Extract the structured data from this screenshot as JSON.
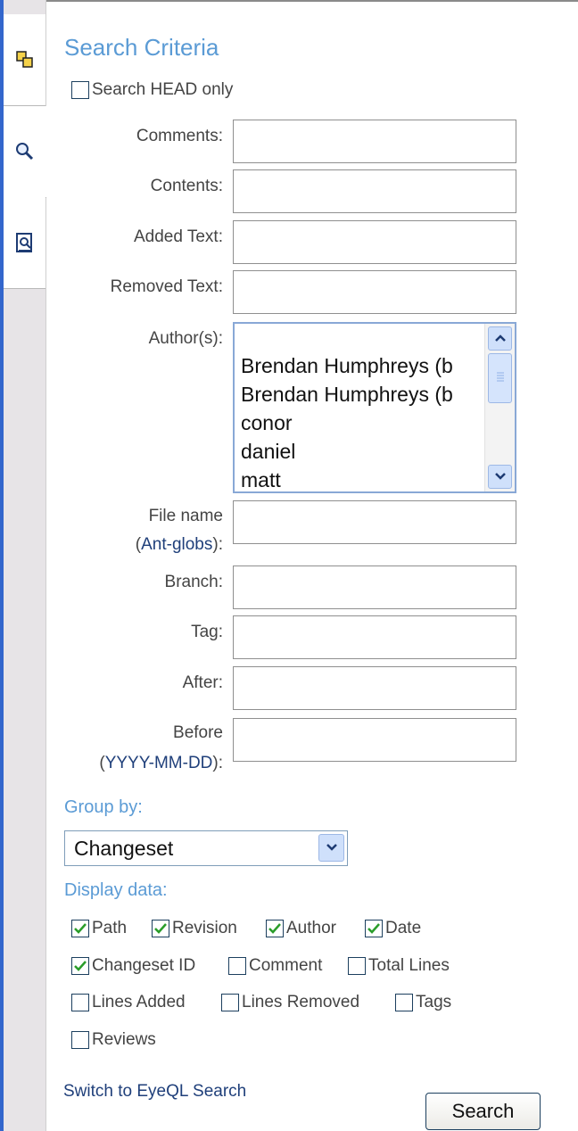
{
  "tabs": [
    {
      "icon": "changesets-icon"
    },
    {
      "icon": "search-icon"
    },
    {
      "icon": "reviews-icon"
    }
  ],
  "title": "Search Criteria",
  "head_only": {
    "label": "Search HEAD only",
    "checked": false
  },
  "fields": {
    "comments": {
      "label": "Comments:",
      "value": ""
    },
    "contents": {
      "label": "Contents:",
      "value": ""
    },
    "added_text": {
      "label": "Added Text:",
      "value": ""
    },
    "removed_text": {
      "label": "Removed Text:",
      "value": ""
    },
    "authors": {
      "label": "Author(s):",
      "options": [
        "",
        "Brendan Humphreys (b",
        "Brendan Humphreys (b",
        "conor",
        "daniel",
        "matt"
      ]
    },
    "file_name": {
      "label": "File name",
      "link": "Ant-globs",
      "open": "(",
      "close": "):",
      "value": ""
    },
    "branch": {
      "label": "Branch:",
      "value": ""
    },
    "tag": {
      "label": "Tag:",
      "value": ""
    },
    "after": {
      "label": "After:",
      "value": ""
    },
    "before": {
      "label": "Before",
      "link": "YYYY-MM-DD",
      "open": "(",
      "close": "):",
      "value": ""
    }
  },
  "group_by": {
    "label": "Group by:",
    "selected": "Changeset"
  },
  "display_data": {
    "label": "Display data:",
    "options": [
      {
        "label": "Path",
        "checked": true
      },
      {
        "label": "Revision",
        "checked": true
      },
      {
        "label": "Author",
        "checked": true
      },
      {
        "label": "Date",
        "checked": true
      },
      {
        "label": "Changeset ID",
        "checked": true
      },
      {
        "label": "Comment",
        "checked": false
      },
      {
        "label": "Total Lines",
        "checked": false
      },
      {
        "label": "Lines Added",
        "checked": false
      },
      {
        "label": "Lines Removed",
        "checked": false
      },
      {
        "label": "Tags",
        "checked": false
      },
      {
        "label": "Reviews",
        "checked": false
      }
    ]
  },
  "switch_link": "Switch to EyeQL Search",
  "search_button": "Search",
  "colors": {
    "accent": "#5b9bd5",
    "link": "#1f3f7a",
    "check": "#2a9d2a",
    "sidebar": "#e7e4e7",
    "sidebar_edge": "#3366cc"
  }
}
